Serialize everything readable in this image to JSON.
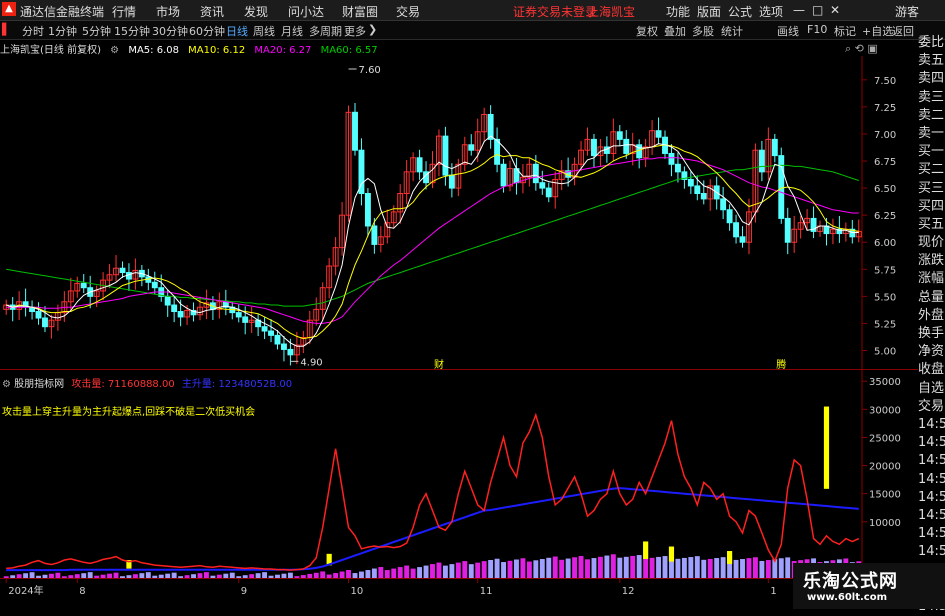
{
  "topbar": {
    "app_title": "通达信金融终端",
    "menu": [
      "行情",
      "市场",
      "资讯",
      "发现",
      "问小达",
      "财富圈",
      "交易"
    ],
    "notice": "证券交易未登录",
    "stock_name": "上海凯宝",
    "right": [
      "功能",
      "版面",
      "公式",
      "选项"
    ],
    "guest": "游客"
  },
  "toolbar": {
    "periods": [
      "分时",
      "1分钟",
      "5分钟",
      "15分钟",
      "30分钟",
      "60分钟",
      "日线",
      "周线",
      "月线",
      "多周期",
      "更多"
    ],
    "active_period": "日线",
    "right": [
      "复权",
      "叠加",
      "多股",
      "统计",
      "画线",
      "F10",
      "标记",
      "+自选",
      "返回"
    ]
  },
  "main_info": {
    "title": "上海凯宝(日线 前复权)",
    "ma5": "MA5: 6.08",
    "ma10": "MA10: 6.12",
    "ma20": "MA20: 6.27",
    "ma60": "MA60: 6.57"
  },
  "indicator_info": {
    "name": "股朋指标网",
    "attack": "攻击量: 71160888.00",
    "main": "主升量: 12348052B.00",
    "note": "攻击量上穿主升量为主升起爆点,回踩不破是二次低买机会"
  },
  "right_list": [
    "委比",
    "卖五",
    "卖四",
    "卖三",
    "卖二",
    "卖一",
    "买一",
    "买二",
    "买三",
    "买四",
    "买五",
    "现价",
    "涨跌",
    "涨幅",
    "总量",
    "外盘",
    "换手",
    "净资",
    "收盘",
    "自选",
    "交易",
    "14:5",
    "14:5",
    "14:5",
    "14:5",
    "14:5",
    "14:5",
    "14:5",
    "14:5",
    "14:5",
    "14:5",
    "14:5"
  ],
  "colors": {
    "up": "#ff3232",
    "down": "#54ffff",
    "ma5": "#ffffff",
    "ma10": "#ffff00",
    "ma20": "#ff00ff",
    "ma60": "#00c000",
    "attack": "#ff2020",
    "mainrise": "#1c1cff",
    "volbar": "#e020e0"
  },
  "watermark": {
    "line1": "乐淘公式网",
    "line2": "www.60lt.com"
  },
  "chart_data": [
    {
      "type": "candlestick",
      "title": "上海凯宝(日线 前复权)",
      "ylim": [
        4.82,
        7.72
      ],
      "y_ticks": [
        "7.50",
        "7.25",
        "7.00",
        "6.75",
        "6.50",
        "6.25",
        "6.00",
        "5.75",
        "5.50",
        "5.25",
        "5.00"
      ],
      "annotations": [
        {
          "label": "7.60",
          "value": 7.6,
          "index": 53
        },
        {
          "label": "4.90",
          "value": 4.9,
          "index": 44
        },
        {
          "label": "财",
          "index": 67
        },
        {
          "label": "腾",
          "index": 120
        }
      ],
      "x_ticks": [
        {
          "label": "2024年",
          "index": 0
        },
        {
          "label": "8",
          "index": 11
        },
        {
          "label": "9",
          "index": 36
        },
        {
          "label": "10",
          "index": 53
        },
        {
          "label": "11",
          "index": 73
        },
        {
          "label": "12",
          "index": 95
        },
        {
          "label": "1",
          "index": 118
        }
      ],
      "close": [
        5.42,
        5.38,
        5.45,
        5.4,
        5.36,
        5.3,
        5.22,
        5.28,
        5.35,
        5.45,
        5.55,
        5.62,
        5.58,
        5.5,
        5.55,
        5.65,
        5.7,
        5.76,
        5.72,
        5.66,
        5.74,
        5.68,
        5.63,
        5.58,
        5.5,
        5.42,
        5.36,
        5.31,
        5.37,
        5.33,
        5.4,
        5.44,
        5.38,
        5.45,
        5.4,
        5.35,
        5.31,
        5.26,
        5.28,
        5.22,
        5.18,
        5.14,
        5.06,
        5.01,
        4.96,
        5.05,
        5.12,
        5.28,
        5.38,
        5.58,
        5.78,
        5.95,
        6.25,
        7.2,
        6.85,
        6.45,
        6.15,
        5.98,
        6.05,
        6.18,
        6.28,
        6.45,
        6.65,
        6.78,
        6.65,
        6.55,
        6.72,
        6.98,
        6.62,
        6.5,
        6.72,
        6.9,
        6.85,
        7.02,
        7.18,
        6.95,
        6.72,
        6.52,
        6.68,
        6.55,
        6.6,
        6.72,
        6.55,
        6.5,
        6.42,
        6.58,
        6.66,
        6.6,
        6.72,
        6.85,
        6.95,
        6.8,
        6.88,
        6.82,
        7.02,
        6.95,
        6.82,
        6.9,
        6.78,
        6.88,
        7.03,
        6.97,
        6.82,
        6.72,
        6.65,
        6.58,
        6.52,
        6.45,
        6.4,
        6.52,
        6.4,
        6.3,
        6.18,
        6.05,
        6.0,
        6.28,
        6.85,
        6.65,
        6.95,
        6.8,
        6.22,
        6.0,
        6.12,
        6.18,
        6.22,
        6.1,
        6.15,
        6.08,
        6.12,
        6.08,
        6.12,
        6.05,
        6.1
      ],
      "ma5": [
        5.42,
        5.4,
        5.41,
        5.41,
        5.4,
        5.38,
        5.35,
        5.31,
        5.3,
        5.32,
        5.37,
        5.45,
        5.51,
        5.54,
        5.56,
        5.58,
        5.6,
        5.63,
        5.68,
        5.7,
        5.72,
        5.71,
        5.69,
        5.66,
        5.63,
        5.56,
        5.5,
        5.43,
        5.39,
        5.36,
        5.35,
        5.37,
        5.38,
        5.4,
        5.41,
        5.4,
        5.38,
        5.35,
        5.32,
        5.28,
        5.25,
        5.22,
        5.18,
        5.12,
        5.07,
        5.04,
        5.04,
        5.08,
        5.16,
        5.28,
        5.43,
        5.59,
        5.79,
        6.15,
        6.41,
        6.54,
        6.59,
        6.54,
        6.3,
        6.14,
        6.13,
        6.19,
        6.32,
        6.47,
        6.56,
        6.62,
        6.67,
        6.74,
        6.7,
        6.68,
        6.71,
        6.74,
        6.72,
        6.8,
        6.93,
        6.98,
        6.94,
        6.88,
        6.81,
        6.68,
        6.61,
        6.61,
        6.62,
        6.58,
        6.56,
        6.55,
        6.54,
        6.55,
        6.6,
        6.68,
        6.76,
        6.78,
        6.84,
        6.86,
        6.89,
        6.89,
        6.9,
        6.9,
        6.87,
        6.87,
        6.88,
        6.91,
        6.9,
        6.88,
        6.84,
        6.75,
        6.66,
        6.58,
        6.52,
        6.5,
        6.46,
        6.42,
        6.37,
        6.29,
        6.19,
        6.16,
        6.27,
        6.37,
        6.55,
        6.72,
        6.7,
        6.52,
        6.42,
        6.26,
        6.11,
        6.12,
        6.15,
        6.15,
        6.13,
        6.11,
        6.11,
        6.09,
        6.09
      ],
      "ma10": [
        5.42,
        5.4,
        5.42,
        5.41,
        5.4,
        5.39,
        5.36,
        5.35,
        5.35,
        5.36,
        5.36,
        5.39,
        5.4,
        5.42,
        5.45,
        5.48,
        5.52,
        5.56,
        5.6,
        5.62,
        5.64,
        5.65,
        5.66,
        5.67,
        5.66,
        5.64,
        5.61,
        5.57,
        5.54,
        5.49,
        5.45,
        5.43,
        5.41,
        5.39,
        5.38,
        5.38,
        5.37,
        5.36,
        5.35,
        5.34,
        5.31,
        5.28,
        5.25,
        5.2,
        5.16,
        5.13,
        5.11,
        5.12,
        5.13,
        5.18,
        5.24,
        5.32,
        5.43,
        5.62,
        5.79,
        5.92,
        6.06,
        6.19,
        6.27,
        6.29,
        6.31,
        6.31,
        6.32,
        6.37,
        6.45,
        6.51,
        6.56,
        6.59,
        6.61,
        6.62,
        6.63,
        6.64,
        6.66,
        6.69,
        6.73,
        6.78,
        6.81,
        6.79,
        6.8,
        6.8,
        6.78,
        6.78,
        6.75,
        6.72,
        6.7,
        6.67,
        6.65,
        6.62,
        6.61,
        6.6,
        6.62,
        6.64,
        6.67,
        6.71,
        6.75,
        6.78,
        6.8,
        6.83,
        6.85,
        6.87,
        6.88,
        6.89,
        6.9,
        6.89,
        6.87,
        6.84,
        6.82,
        6.79,
        6.74,
        6.69,
        6.64,
        6.58,
        6.51,
        6.45,
        6.38,
        6.33,
        6.35,
        6.37,
        6.41,
        6.46,
        6.5,
        6.51,
        6.5,
        6.48,
        6.43,
        6.37,
        6.29,
        6.19,
        6.15,
        6.13,
        6.12,
        6.11,
        6.1
      ],
      "ma20": [
        5.4,
        5.4,
        5.4,
        5.4,
        5.4,
        5.4,
        5.39,
        5.39,
        5.39,
        5.4,
        5.4,
        5.41,
        5.42,
        5.43,
        5.44,
        5.45,
        5.46,
        5.47,
        5.48,
        5.5,
        5.51,
        5.52,
        5.53,
        5.54,
        5.54,
        5.54,
        5.53,
        5.52,
        5.51,
        5.5,
        5.49,
        5.48,
        5.47,
        5.46,
        5.45,
        5.44,
        5.43,
        5.42,
        5.41,
        5.4,
        5.39,
        5.37,
        5.35,
        5.33,
        5.31,
        5.29,
        5.27,
        5.26,
        5.25,
        5.25,
        5.26,
        5.28,
        5.31,
        5.38,
        5.45,
        5.51,
        5.57,
        5.63,
        5.69,
        5.74,
        5.79,
        5.83,
        5.88,
        5.93,
        5.98,
        6.03,
        6.08,
        6.13,
        6.17,
        6.21,
        6.25,
        6.29,
        6.33,
        6.37,
        6.41,
        6.45,
        6.48,
        6.51,
        6.53,
        6.55,
        6.57,
        6.59,
        6.6,
        6.61,
        6.62,
        6.63,
        6.64,
        6.65,
        6.66,
        6.67,
        6.68,
        6.69,
        6.7,
        6.71,
        6.72,
        6.73,
        6.74,
        6.75,
        6.76,
        6.77,
        6.77,
        6.78,
        6.78,
        6.78,
        6.78,
        6.77,
        6.76,
        6.75,
        6.73,
        6.71,
        6.69,
        6.67,
        6.64,
        6.61,
        6.58,
        6.55,
        6.53,
        6.51,
        6.5,
        6.48,
        6.46,
        6.44,
        6.42,
        6.4,
        6.38,
        6.36,
        6.34,
        6.32,
        6.3,
        6.29,
        6.28,
        6.27,
        6.27
      ],
      "ma60": [
        5.75,
        5.74,
        5.73,
        5.72,
        5.71,
        5.7,
        5.69,
        5.68,
        5.67,
        5.66,
        5.65,
        5.64,
        5.63,
        5.62,
        5.61,
        5.6,
        5.59,
        5.58,
        5.57,
        5.56,
        5.55,
        5.54,
        5.53,
        5.52,
        5.51,
        5.5,
        5.5,
        5.49,
        5.49,
        5.48,
        5.48,
        5.47,
        5.47,
        5.46,
        5.46,
        5.45,
        5.45,
        5.44,
        5.44,
        5.43,
        5.43,
        5.42,
        5.42,
        5.41,
        5.41,
        5.41,
        5.41,
        5.42,
        5.43,
        5.44,
        5.46,
        5.48,
        5.5,
        5.53,
        5.56,
        5.59,
        5.62,
        5.64,
        5.66,
        5.68,
        5.7,
        5.72,
        5.74,
        5.76,
        5.78,
        5.8,
        5.82,
        5.84,
        5.86,
        5.88,
        5.9,
        5.92,
        5.94,
        5.96,
        5.98,
        6.0,
        6.02,
        6.04,
        6.06,
        6.08,
        6.1,
        6.12,
        6.14,
        6.16,
        6.18,
        6.2,
        6.22,
        6.24,
        6.26,
        6.28,
        6.3,
        6.32,
        6.34,
        6.36,
        6.38,
        6.4,
        6.42,
        6.44,
        6.46,
        6.48,
        6.5,
        6.52,
        6.54,
        6.56,
        6.58,
        6.59,
        6.6,
        6.61,
        6.62,
        6.63,
        6.64,
        6.65,
        6.66,
        6.67,
        6.67,
        6.68,
        6.69,
        6.7,
        6.7,
        6.71,
        6.71,
        6.71,
        6.7,
        6.7,
        6.69,
        6.68,
        6.67,
        6.66,
        6.65,
        6.63,
        6.61,
        6.59,
        6.57
      ]
    },
    {
      "type": "line",
      "title": "股朋指标网",
      "ylim": [
        0,
        37000
      ],
      "y_ticks": [
        "35000",
        "30000",
        "25000",
        "20000",
        "15000",
        "10000"
      ],
      "series": [
        {
          "name": "攻击量",
          "values": [
            1700,
            1800,
            2100,
            2300,
            2800,
            3100,
            2600,
            2400,
            2700,
            3200,
            3400,
            3100,
            2800,
            2600,
            2900,
            3300,
            3500,
            3800,
            3200,
            2900,
            3100,
            2700,
            2500,
            2300,
            2200,
            2100,
            2000,
            1900,
            2000,
            2100,
            2200,
            2000,
            1900,
            2100,
            2000,
            1900,
            1800,
            1700,
            1800,
            1700,
            1600,
            1600,
            1500,
            1500,
            1400,
            1500,
            1600,
            2200,
            3600,
            9000,
            16000,
            23000,
            16000,
            9000,
            7500,
            5200,
            5500,
            5700,
            5500,
            5600,
            5400,
            5600,
            6200,
            9000,
            13000,
            15000,
            12000,
            9000,
            8500,
            10000,
            15000,
            19000,
            16000,
            13000,
            12000,
            17000,
            21000,
            25000,
            20000,
            18000,
            24000,
            26000,
            29000,
            25000,
            18000,
            13000,
            14000,
            16000,
            18000,
            15000,
            11000,
            12000,
            14000,
            15000,
            19000,
            15000,
            13000,
            14000,
            17000,
            15000,
            18000,
            21000,
            24000,
            28000,
            22000,
            18000,
            16000,
            13000,
            17000,
            16000,
            14000,
            15000,
            11000,
            10000,
            8000,
            12000,
            11000,
            8000,
            5000,
            3000,
            6000,
            16000,
            21000,
            20000,
            14000,
            7000,
            6000,
            7500,
            6500,
            6000,
            7000,
            6500,
            7000
          ]
        },
        {
          "name": "主升量",
          "values": [
            1400,
            1400,
            1400,
            1400,
            1400,
            1400,
            1400,
            1400,
            1400,
            1400,
            1450,
            1450,
            1450,
            1450,
            1450,
            1450,
            1450,
            1450,
            1450,
            1450,
            1450,
            1450,
            1450,
            1450,
            1450,
            1450,
            1450,
            1450,
            1450,
            1450,
            1450,
            1450,
            1450,
            1450,
            1450,
            1450,
            1450,
            1450,
            1450,
            1450,
            1450,
            1450,
            1450,
            1450,
            1450,
            1500,
            1550,
            1650,
            1800,
            2050,
            2400,
            2800,
            3200,
            3600,
            4000,
            4400,
            4800,
            5200,
            5600,
            6000,
            6400,
            6800,
            7200,
            7600,
            8000,
            8400,
            8800,
            9200,
            9600,
            10000,
            10400,
            10800,
            11200,
            11600,
            12000,
            12100,
            12300,
            12500,
            12700,
            12900,
            13100,
            13300,
            13500,
            13700,
            13900,
            14100,
            14300,
            14500,
            14700,
            14900,
            15100,
            15300,
            15500,
            15700,
            15900,
            16000,
            15900,
            15800,
            15700,
            15600,
            15500,
            15400,
            15300,
            15200,
            15100,
            15000,
            14900,
            14800,
            14700,
            14600,
            14500,
            14400,
            14300,
            14200,
            14100,
            14000,
            13900,
            13800,
            13700,
            13600,
            13500,
            13400,
            13300,
            13200,
            13100,
            13000,
            12900,
            12800,
            12700,
            12600,
            12500,
            12400,
            12300
          ]
        },
        {
          "name": "起爆点",
          "type": "bar",
          "points": [
            {
              "index": 19,
              "value": 3200
            },
            {
              "index": 50,
              "value": 4300
            },
            {
              "index": 99,
              "value": 6500
            },
            {
              "index": 103,
              "value": 5600
            },
            {
              "index": 112,
              "value": 4800
            },
            {
              "index": 127,
              "value": 30500
            }
          ]
        }
      ]
    }
  ]
}
